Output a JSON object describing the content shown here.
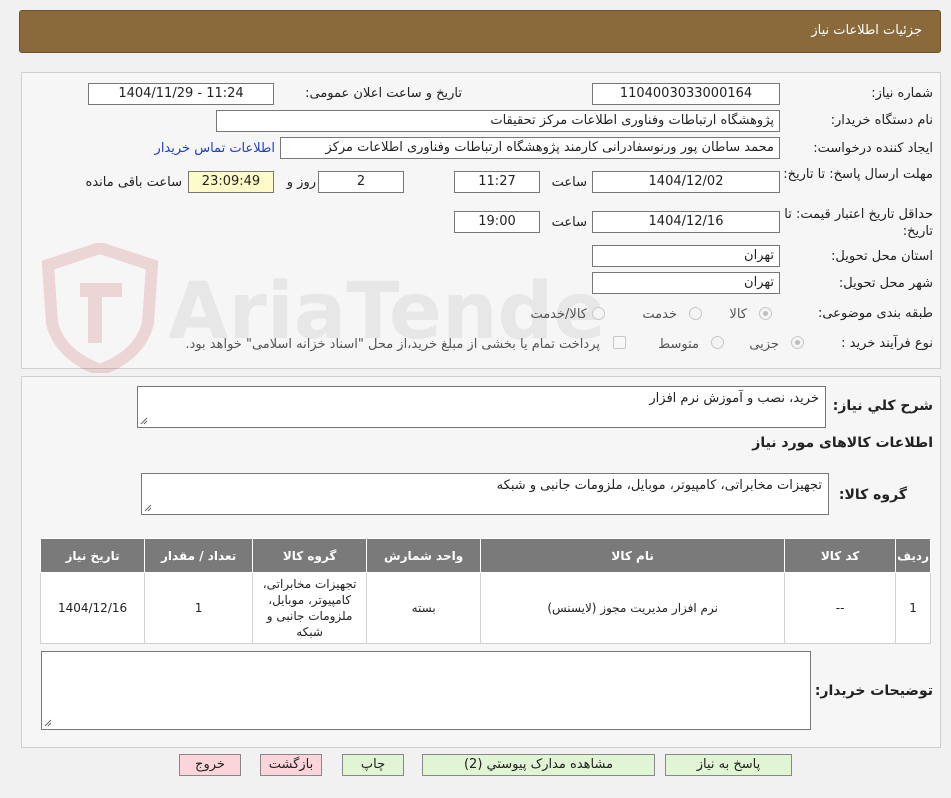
{
  "header": {
    "title": "جزئیات اطلاعات نیاز"
  },
  "form": {
    "need_number_label": "شماره نیاز:",
    "need_number": "1104003033000164",
    "announce_label": "تاریخ و ساعت اعلان عمومی:",
    "announce_value": "1404/11/29 - 11:24",
    "buyer_org_label": "نام دستگاه خریدار:",
    "buyer_org": "پژوهشگاه ارتباطات وفناوری اطلاعات مرکز تحقیقات",
    "creator_label": "ایجاد کننده درخواست:",
    "creator": "محمد ساطان پور ورنوسفادرانی کارمند پژوهشگاه ارتباطات وفناوری اطلاعات مرکز",
    "contact_link": "اطلاعات تماس خریدار",
    "deadline_label": "مهلت ارسال پاسخ: تا تاریخ:",
    "deadline_date": "1404/12/02",
    "time_label": "ساعت",
    "deadline_time": "11:27",
    "days_value": "2",
    "days_label": "روز و",
    "remaining_time": "23:09:49",
    "remaining_label": "ساعت باقی مانده",
    "validity_label": "حداقل تاریخ اعتبار قیمت: تا تاریخ:",
    "validity_date": "1404/12/16",
    "validity_time": "19:00",
    "province_label": "استان محل تحویل:",
    "province": "تهران",
    "city_label": "شهر محل تحویل:",
    "city": "تهران",
    "category_label": "طبقه بندی موضوعی:",
    "cat_goods": "کالا",
    "cat_service": "خدمت",
    "cat_goods_service": "کالا/خدمت",
    "process_label": "نوع فرآیند خرید :",
    "proc_partial": "جزیی",
    "proc_medium": "متوسط",
    "treasury_note": "پرداخت تمام یا بخشی از مبلغ خرید،از محل \"اسناد خزانه اسلامی\" خواهد بود."
  },
  "watermark": "AriaTender.neT",
  "summary": {
    "desc_label": "شرح کلي نياز:",
    "desc_value": "خرید، نصب و آموزش نرم افزار",
    "goods_info_title": "اطلاعات کالاهای مورد نیاز",
    "group_label": "گروه کالا:",
    "group_value": "تجهیزات مخابراتی، کامپیوتر، موبایل، ملزومات جانبی و شبکه"
  },
  "table": {
    "headers": [
      "ردیف",
      "کد کالا",
      "نام کالا",
      "واحد شمارش",
      "گروه کالا",
      "تعداد / مقدار",
      "تاریخ نیاز"
    ],
    "rows": [
      [
        "1",
        "--",
        "نرم افزار مدیریت مجوز (لایسنس)",
        "بسته",
        "تجهیزات مخابراتی، کامپیوتر، موبایل، ملزومات جانبی و شبکه",
        "1",
        "1404/12/16"
      ]
    ]
  },
  "buyer_notes": {
    "label": "توضیحات خریدار:",
    "value": ""
  },
  "buttons": {
    "reply": "پاسخ به نیاز",
    "attachments": "مشاهده مدارک پیوستي (2)",
    "print": "چاپ",
    "back": "بازگشت",
    "exit": "خروج"
  },
  "colors": {
    "header_bg": "#8a6a3a",
    "table_header_bg": "#7a7a7a",
    "green_button": "#dff5d4",
    "pink_button": "#fbd5d9",
    "link": "#1e40c8"
  }
}
